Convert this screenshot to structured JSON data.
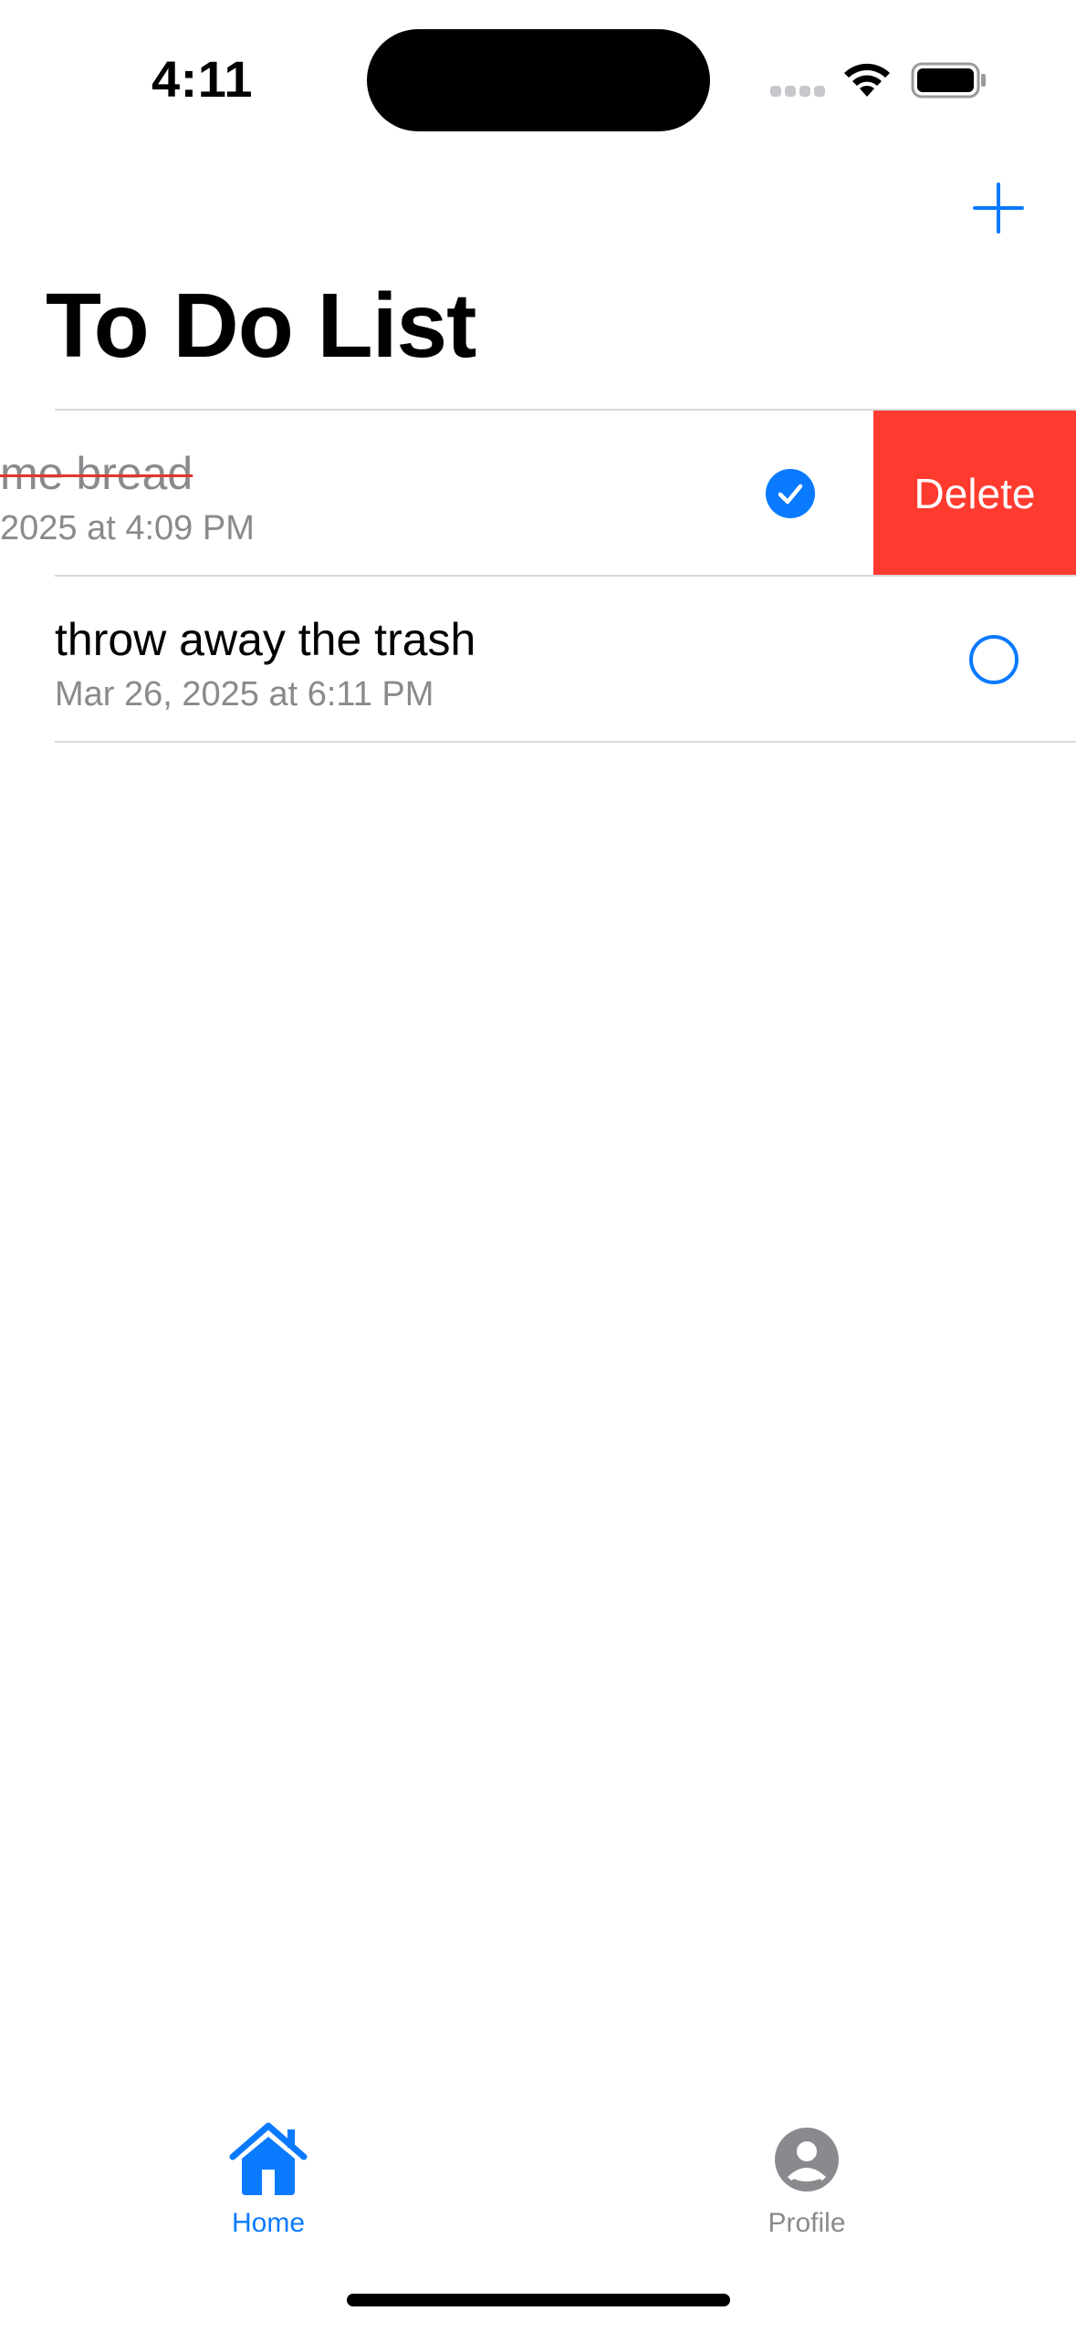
{
  "status_bar": {
    "time": "4:11",
    "icons": [
      "cellular-signal-icon",
      "wifi-icon",
      "battery-icon"
    ]
  },
  "nav": {
    "title": "To Do List",
    "add_icon": "plus-icon"
  },
  "tasks": [
    {
      "title": "me bread",
      "date": "2025 at 4:09 PM",
      "completed": true,
      "swiped": true,
      "action_label": "Delete"
    },
    {
      "title": "throw away the trash",
      "date": "Mar 26, 2025 at 6:11 PM",
      "completed": false,
      "swiped": false
    }
  ],
  "tab_bar": {
    "tabs": [
      {
        "label": "Home",
        "icon": "house-icon",
        "active": true
      },
      {
        "label": "Profile",
        "icon": "person-circle-icon",
        "active": false
      }
    ]
  },
  "colors": {
    "accent": "#0a7aff",
    "destructive": "#ff3b30",
    "secondary_text": "#8a8a8e",
    "separator": "#d9d9dd",
    "strike": "#e5352b"
  }
}
